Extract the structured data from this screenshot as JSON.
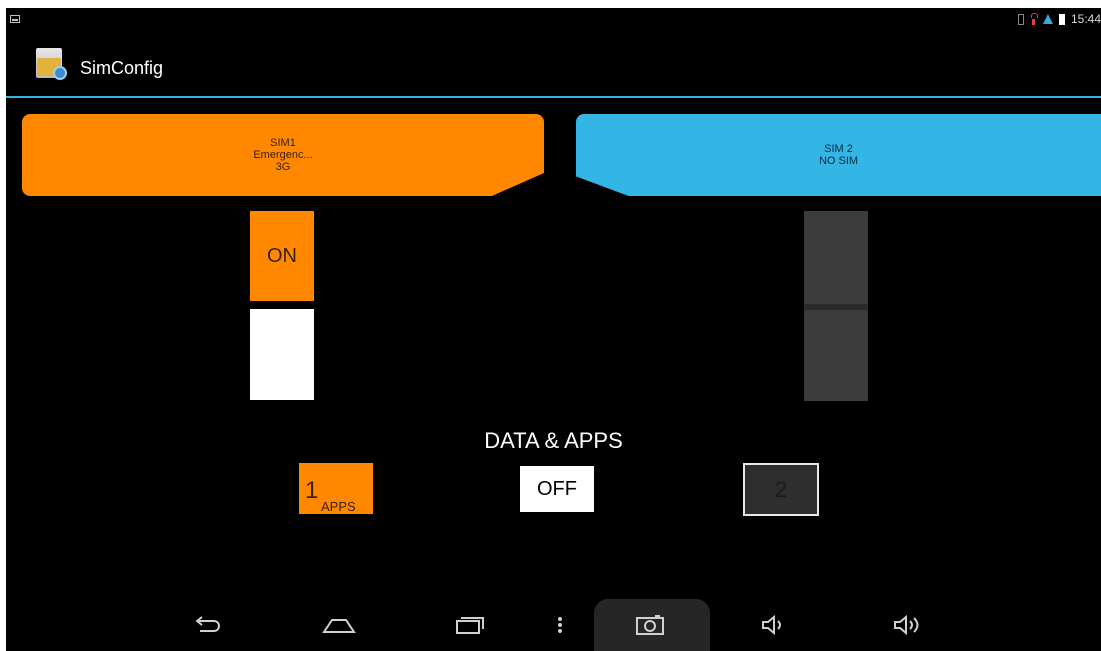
{
  "status_bar": {
    "time": "15:44",
    "icons": [
      "notification-icon",
      "sim-icon",
      "warning-icon",
      "wifi-icon",
      "battery-icon"
    ]
  },
  "app": {
    "title": "SimConfig",
    "icon": "simconfig-app-icon"
  },
  "sims": [
    {
      "line1": "SIM1",
      "line2": "Emergenc...",
      "line3": "3G",
      "color": "#ff8800"
    },
    {
      "line1": "SIM 2",
      "line2": "NO SIM",
      "color": "#33b5e5"
    }
  ],
  "toggles": {
    "sim1": {
      "state_label": "ON",
      "color": "#ff8800"
    },
    "sim2": {
      "state_label": "",
      "color": "#3c3c3c"
    }
  },
  "data_apps": {
    "title": "DATA & APPS",
    "sim1_number": "1",
    "sim1_label": "APPS",
    "off_label": "OFF",
    "sim2_number": "2"
  },
  "nav": {
    "buttons": [
      "back-icon",
      "home-icon",
      "recents-icon",
      "menu-icon",
      "screenshot-icon",
      "volume-down-icon",
      "volume-up-icon"
    ]
  },
  "colors": {
    "accent": "#33b5e5",
    "sim1": "#ff8800",
    "sim2": "#33b5e5",
    "background": "#000000"
  }
}
